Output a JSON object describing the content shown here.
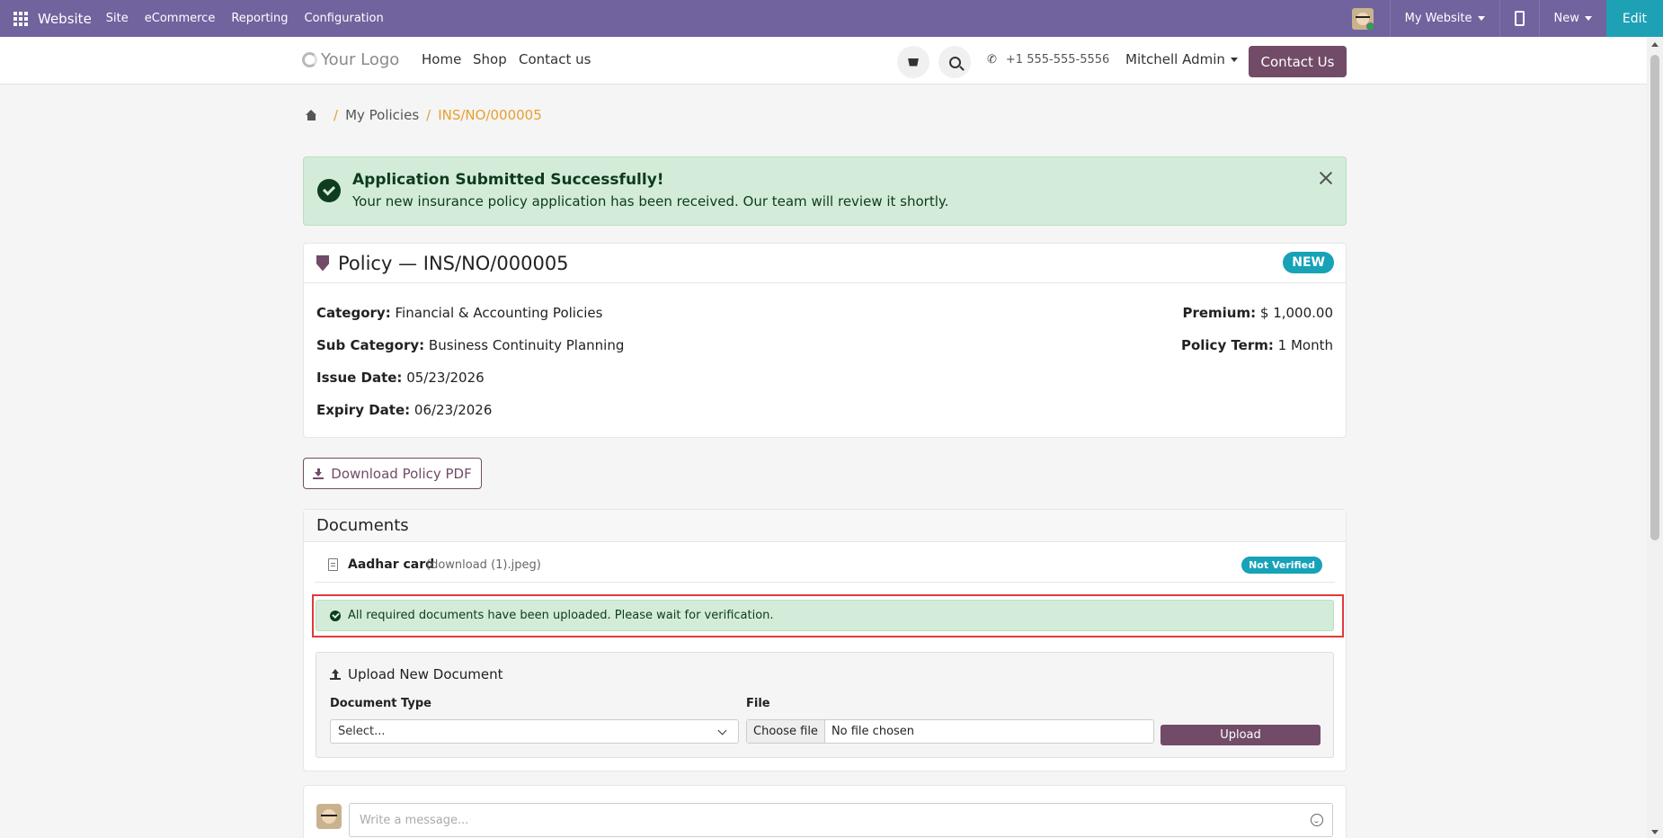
{
  "admin_bar": {
    "brand": "Website",
    "menus": [
      "Site",
      "eCommerce",
      "Reporting",
      "Configuration"
    ],
    "my_website": "My Website",
    "new_label": "New",
    "edit_label": "Edit"
  },
  "header": {
    "logo_text": "Your Logo",
    "nav": [
      "Home",
      "Shop",
      "Contact us"
    ],
    "phone": "+1 555-555-5556",
    "user": "Mitchell Admin",
    "cta": "Contact Us"
  },
  "breadcrumb": {
    "sep": "/",
    "items": [
      "My Policies",
      "INS/NO/000005"
    ]
  },
  "success_alert": {
    "title": "Application Submitted Successfully!",
    "message": "Your new insurance policy application has been received. Our team will review it shortly."
  },
  "policy": {
    "title": "Policy — INS/NO/000005",
    "status": "NEW",
    "fields_left": [
      {
        "label": "Category:",
        "value": "Financial & Accounting Policies"
      },
      {
        "label": "Sub Category:",
        "value": "Business Continuity Planning"
      },
      {
        "label": "Issue Date:",
        "value": "05/23/2026"
      },
      {
        "label": "Expiry Date:",
        "value": "06/23/2026"
      }
    ],
    "fields_right": [
      {
        "label": "Premium:",
        "value": "$ 1,000.00"
      },
      {
        "label": "Policy Term:",
        "value": "1 Month"
      }
    ]
  },
  "download_label": "Download Policy PDF",
  "documents": {
    "heading": "Documents",
    "items": [
      {
        "name": "Aadhar card",
        "file": "(download (1).jpeg)",
        "status": "Not Verified"
      }
    ],
    "notice": "All required documents have been uploaded. Please wait for verification."
  },
  "upload": {
    "title": "Upload New Document",
    "doc_type_label": "Document Type",
    "doc_type_value": "Select...",
    "file_label": "File",
    "choose_label": "Choose file",
    "no_file_label": "No file chosen",
    "button_label": "Upload"
  },
  "composer": {
    "placeholder": "Write a message..."
  },
  "colors": {
    "admin_bar": "#71639e",
    "brand": "#714b67",
    "success_bg": "#d3ecd9",
    "info_badge": "#17a2b8",
    "breadcrumb_active": "#e6a02d",
    "highlight": "#e03a3a"
  }
}
